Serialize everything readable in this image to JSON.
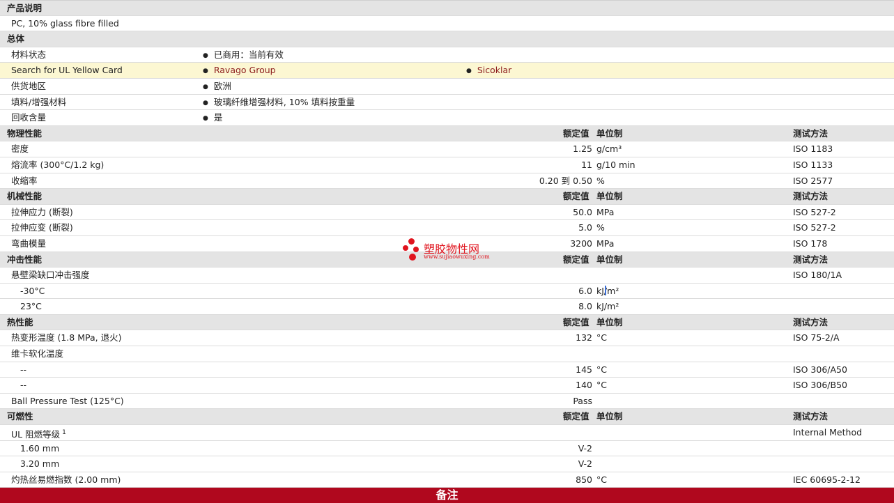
{
  "description_header": "产品说明",
  "description_text": "PC, 10% glass fibre filled",
  "general": {
    "header": "总体",
    "status": {
      "label": "材料状态",
      "value": "已商用：当前有效"
    },
    "ul_card": {
      "label": "Search for UL Yellow Card",
      "link1": "Ravago Group",
      "link2": "Sicoklar"
    },
    "region": {
      "label": "供货地区",
      "value": "欧洲"
    },
    "filler": {
      "label": "填料/增强材料",
      "value": "玻璃纤维增强材料, 10% 填料按重量"
    },
    "recycled": {
      "label": "回收含量",
      "value": "是"
    }
  },
  "columns": {
    "rated": "额定值",
    "unit": "单位制",
    "test": "测试方法"
  },
  "physical": {
    "header": "物理性能",
    "rows": [
      {
        "label": "密度",
        "value": "1.25",
        "unit": "g/cm³",
        "test": "ISO 1183"
      },
      {
        "label": "熔流率 (300°C/1.2 kg)",
        "value": "11",
        "unit": "g/10 min",
        "test": "ISO 1133"
      },
      {
        "label": "收缩率",
        "value": "0.20 到  0.50",
        "unit": "%",
        "test": "ISO 2577"
      }
    ]
  },
  "mechanical": {
    "header": "机械性能",
    "rows": [
      {
        "label": "拉伸应力 (断裂)",
        "value": "50.0",
        "unit": "MPa",
        "test": "ISO 527-2"
      },
      {
        "label": "拉伸应变 (断裂)",
        "value": "5.0",
        "unit": "%",
        "test": "ISO 527-2"
      },
      {
        "label": "弯曲模量",
        "value": "3200",
        "unit": "MPa",
        "test": "ISO 178"
      }
    ]
  },
  "impact": {
    "header": "冲击性能",
    "main_label": "悬壁梁缺口冲击强度",
    "main_test": "ISO 180/1A",
    "sub": [
      {
        "label": "-30°C",
        "value": "6.0",
        "unit": "kJ/m²"
      },
      {
        "label": "23°C",
        "value": "8.0",
        "unit": "kJ/m²"
      }
    ]
  },
  "thermal": {
    "header": "热性能",
    "hdt": {
      "label": "热变形温度 (1.8 MPa, 退火)",
      "value": "132",
      "unit": "°C",
      "test": "ISO 75-2/A"
    },
    "vicat_label": "维卡软化温度",
    "vicat": [
      {
        "label": "--",
        "value": "145",
        "unit": "°C",
        "test": "ISO 306/A50"
      },
      {
        "label": "--",
        "value": "140",
        "unit": "°C",
        "test": "ISO 306/B50"
      }
    ],
    "ball": {
      "label": "Ball Pressure Test (125°C)",
      "value": "Pass"
    }
  },
  "flammability": {
    "header": "可燃性",
    "ul_label": "UL 阻燃等级",
    "ul_sup": "1",
    "ul_test": "Internal Method",
    "ul_rows": [
      {
        "label": "1.60 mm",
        "value": "V-2"
      },
      {
        "label": "3.20 mm",
        "value": "V-2"
      }
    ],
    "gwfi": {
      "label": "灼热丝易燃指数 (2.00 mm)",
      "value": "850",
      "unit": "°C",
      "test": "IEC 60695-2-12"
    }
  },
  "footer_title": "备注",
  "watermark": {
    "text": "塑胶物性网",
    "url": "www.sujiaowuxing.com"
  },
  "colors": {
    "header_bg": "#e4e4e4",
    "highlight_bg": "#fcf7d2",
    "link": "#8b1a1a",
    "footer_bg": "#b0081e",
    "watermark": "#e0141e"
  }
}
